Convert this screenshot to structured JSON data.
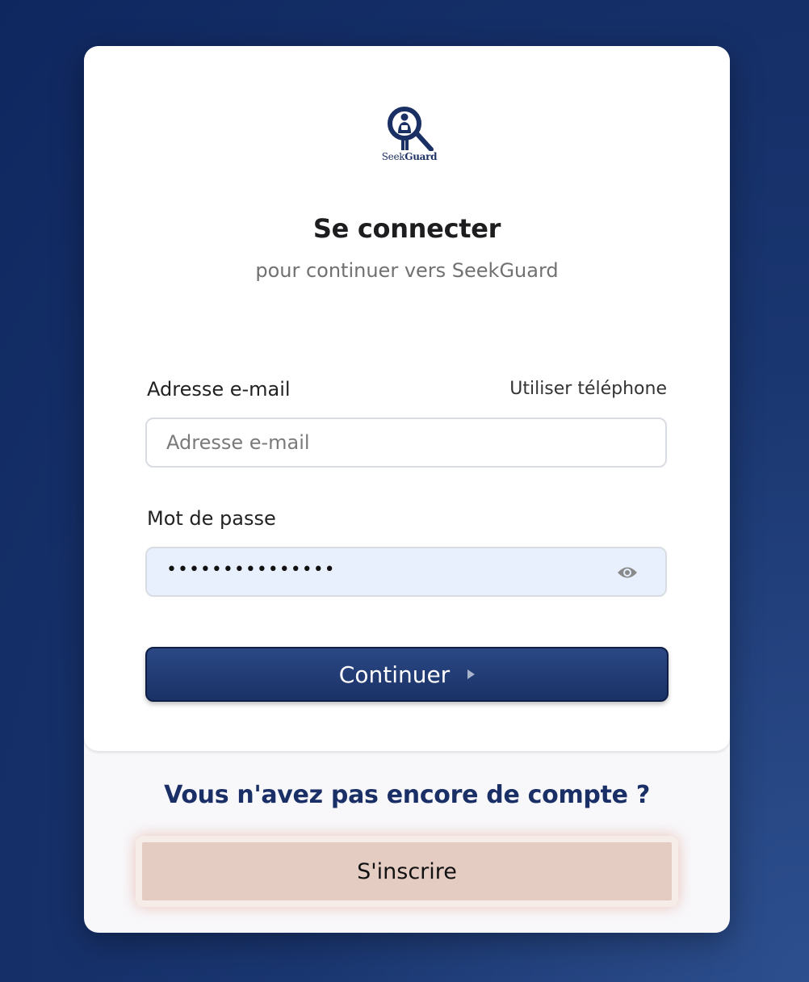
{
  "logo": {
    "text_regular": "Seek",
    "text_bold": "Guard",
    "icon": "magnifier-person-icon"
  },
  "header": {
    "title": "Se connecter",
    "subtitle": "pour continuer vers SeekGuard"
  },
  "form": {
    "email_label": "Adresse e-mail",
    "use_phone_link": "Utiliser téléphone",
    "email_placeholder": "Adresse e-mail",
    "email_value": "",
    "password_label": "Mot de passe",
    "password_masked": "•••••••••••••••",
    "show_password_icon": "eye-icon",
    "continue_label": "Continuer",
    "continue_icon": "play-arrow-icon"
  },
  "footer": {
    "no_account_text": "Vous n'avez pas encore de compte ?",
    "signup_label": "S'inscrire"
  },
  "colors": {
    "brand": "#1a3266",
    "signup_bg": "#e5ccc3",
    "password_field_bg": "#e8f0fe"
  }
}
